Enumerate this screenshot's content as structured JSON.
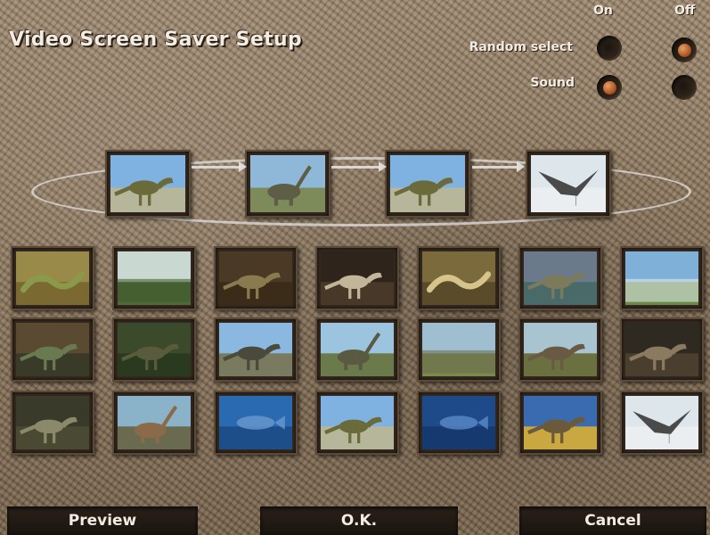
{
  "title": "Video Screen Saver Setup",
  "options": {
    "on_label": "On",
    "off_label": "Off",
    "random_select": {
      "label": "Random select",
      "value": "Off"
    },
    "sound": {
      "label": "Sound",
      "value": "On"
    }
  },
  "sequence": [
    {
      "scene": "theropod-walking",
      "sky": "#7fb2e0",
      "ground": "#b6b79a",
      "creature": "#6b6a3a"
    },
    {
      "scene": "sauropod-herd",
      "sky": "#8fb8d8",
      "ground": "#7d8a5a",
      "creature": "#5e5d45"
    },
    {
      "scene": "theropod-walking",
      "sky": "#7fb2e0",
      "ground": "#b6b79a",
      "creature": "#6b6a3a"
    },
    {
      "scene": "pterosaur-flying",
      "sky": "#dde6ea",
      "ground": "#eaeef0",
      "creature": "#4a4a4a"
    }
  ],
  "grid": [
    [
      {
        "scene": "snake-on-sand",
        "sky": "#9a8a4a",
        "ground": "#7a6a32",
        "creature": "#8b9a4a"
      },
      {
        "scene": "forest-clearing",
        "sky": "#c9d8d0",
        "ground": "#4f6a38",
        "creature": "#3e552c"
      },
      {
        "scene": "nest-closeup",
        "sky": "#4a3a25",
        "ground": "#3a2c18",
        "creature": "#8a7a50"
      },
      {
        "scene": "dark-creature",
        "sky": "#2e241c",
        "ground": "#473828",
        "creature": "#c2b69a"
      },
      {
        "scene": "lizard-head",
        "sky": "#7a6a3c",
        "ground": "#5a4c2a",
        "creature": "#d6c48a"
      },
      {
        "scene": "swimming-reptile",
        "sky": "#6b7a8a",
        "ground": "#4a6a6a",
        "creature": "#7b7a5a"
      },
      {
        "scene": "waterfall-landscape",
        "sky": "#7fb0d8",
        "ground": "#6b8a4a",
        "creature": "#e8eef0"
      }
    ],
    [
      {
        "scene": "shadowy-reptile",
        "sky": "#5a4a32",
        "ground": "#3a3a28",
        "creature": "#6a7a50"
      },
      {
        "scene": "jungle-dinosaur",
        "sky": "#3a4a2a",
        "ground": "#2a3a1e",
        "creature": "#5a5a3c"
      },
      {
        "scene": "theropod-sky",
        "sky": "#8ab8e0",
        "ground": "#7a7a60",
        "creature": "#4a4a3a"
      },
      {
        "scene": "sauropod-herd",
        "sky": "#9cc4de",
        "ground": "#6a7a4a",
        "creature": "#5a5a42"
      },
      {
        "scene": "open-plain",
        "sky": "#9fbfd0",
        "ground": "#7a8a4a",
        "creature": "#6a6a50"
      },
      {
        "scene": "horned-dinosaur",
        "sky": "#a8c4d0",
        "ground": "#6a7040",
        "creature": "#6a5a44"
      },
      {
        "scene": "dark-predator",
        "sky": "#2e2a22",
        "ground": "#4a3e2e",
        "creature": "#8a7a60"
      }
    ],
    [
      {
        "scene": "shadow-creature",
        "sky": "#3a3a2a",
        "ground": "#4a4a34",
        "creature": "#8a8a6a"
      },
      {
        "scene": "long-neck-shore",
        "sky": "#8ab2c8",
        "ground": "#6a6a50",
        "creature": "#8a6a48"
      },
      {
        "scene": "ocean-blue",
        "sky": "#2a6ab0",
        "ground": "#1e4e8a",
        "creature": "#6a9ad0"
      },
      {
        "scene": "theropod-walking",
        "sky": "#7fb2e0",
        "ground": "#b6b79a",
        "creature": "#6b6a3a"
      },
      {
        "scene": "deep-sea-fish",
        "sky": "#1e4a8a",
        "ground": "#163a70",
        "creature": "#5a8ac8"
      },
      {
        "scene": "water-dinosaur",
        "sky": "#3a6ab0",
        "ground": "#c9a842",
        "creature": "#6a5a3a"
      },
      {
        "scene": "pterosaur-flying",
        "sky": "#dde6ea",
        "ground": "#eaeef0",
        "creature": "#4a4a4a"
      }
    ]
  ],
  "buttons": {
    "preview": "Preview",
    "ok": "O.K.",
    "cancel": "Cancel"
  }
}
